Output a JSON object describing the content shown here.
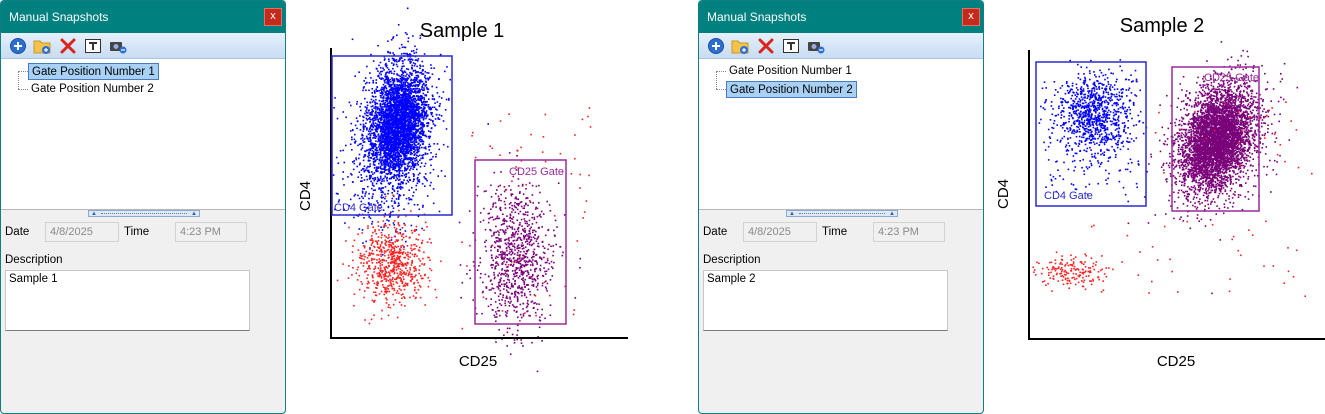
{
  "panels": [
    {
      "window_title": "Manual Snapshots",
      "close_label": "x",
      "tree": [
        "Gate Position Number 1",
        "Gate Position Number 2"
      ],
      "selected": 0,
      "date_label": "Date",
      "date_value": "4/8/2025",
      "time_label": "Time",
      "time_value": "4:23 PM",
      "description_label": "Description",
      "description_value": "Sample 1"
    },
    {
      "window_title": "Manual Snapshots",
      "close_label": "x",
      "tree": [
        "Gate Position Number 1",
        "Gate Position Number 2"
      ],
      "selected": 1,
      "date_label": "Date",
      "date_value": "4/8/2025",
      "time_label": "Time",
      "time_value": "4:23 PM",
      "description_label": "Description",
      "description_value": "Sample 2"
    }
  ],
  "toolbar_icons": [
    "add-icon",
    "new-folder-icon",
    "delete-icon",
    "rename-icon",
    "snapshot-icon"
  ],
  "colors": {
    "titlebar": "#00807f",
    "cd4_gate": "#2a2ad0",
    "cd25_gate": "#9a2a9a",
    "cd4_cells": "#0000ff",
    "cd25_cells": "#7a007a",
    "negative_cells": "#ff2020"
  },
  "plots": [
    {
      "title": "Sample 1",
      "xlabel": "CD25",
      "ylabel": "CD4",
      "gates": [
        {
          "label": "CD4 Gate",
          "color": "#2a2ad0"
        },
        {
          "label": "CD25 Gate",
          "color": "#9a2a9a"
        }
      ]
    },
    {
      "title": "Sample 2",
      "xlabel": "CD25",
      "ylabel": "CD4",
      "gates": [
        {
          "label": "CD4 Gate",
          "color": "#2a2ad0"
        },
        {
          "label": "CD25 Gate",
          "color": "#9a2a9a"
        }
      ]
    }
  ]
}
